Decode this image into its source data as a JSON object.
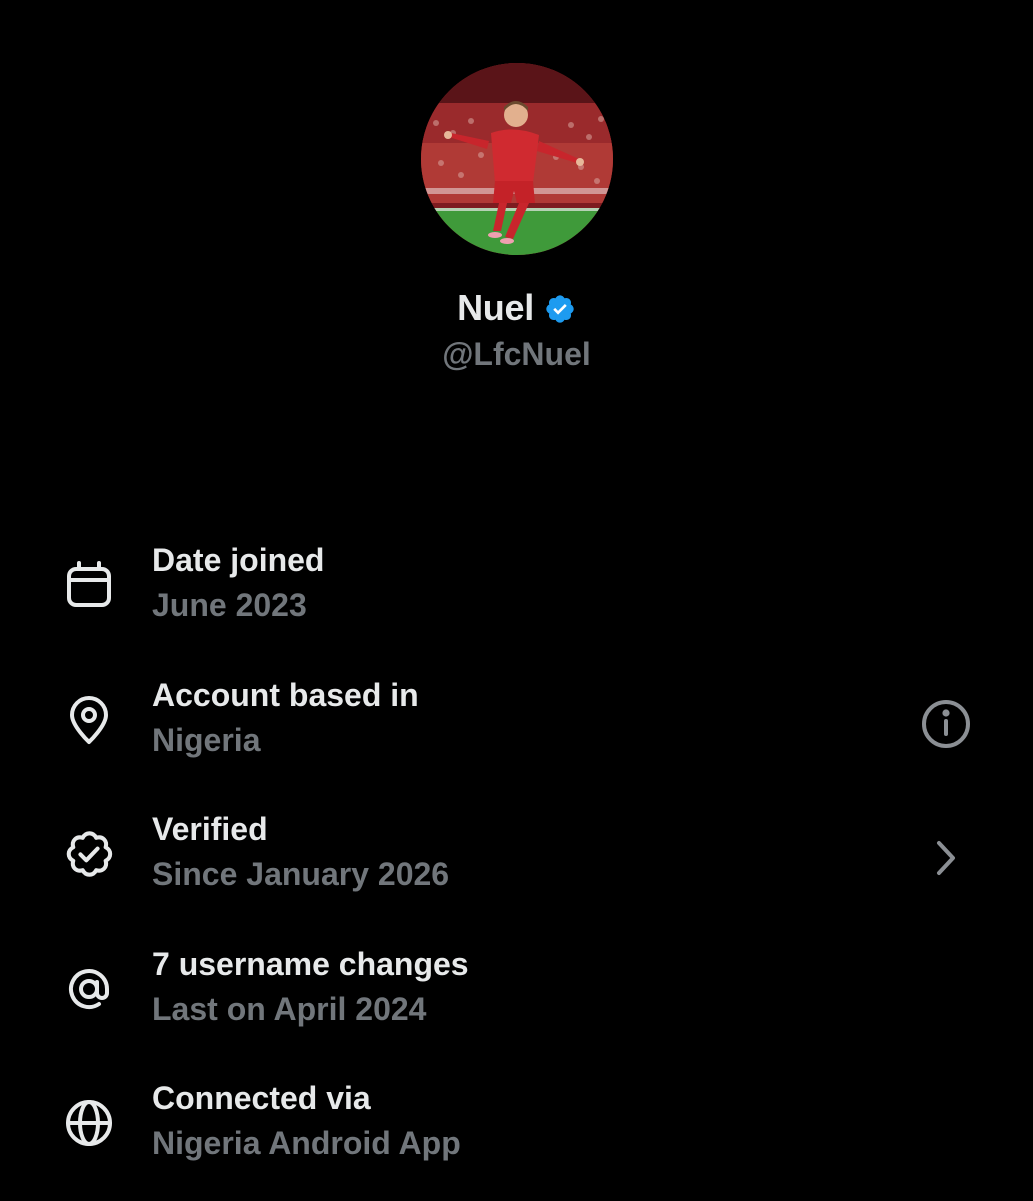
{
  "profile": {
    "display_name": "Nuel",
    "handle": "@LfcNuel",
    "verified": true,
    "verified_badge_color": "#1d9bf0"
  },
  "info_rows": [
    {
      "icon": "calendar-icon",
      "title": "Date joined",
      "subtitle": "June 2023"
    },
    {
      "icon": "location-pin-icon",
      "title": "Account based in",
      "subtitle": "Nigeria",
      "action_icon": "info-icon"
    },
    {
      "icon": "verified-outline-icon",
      "title": "Verified",
      "subtitle": "Since January 2026",
      "action_icon": "chevron-right-icon"
    },
    {
      "icon": "at-sign-icon",
      "title": "7 username changes",
      "subtitle": "Last on April 2024"
    },
    {
      "icon": "globe-icon",
      "title": "Connected via",
      "subtitle": "Nigeria Android App"
    }
  ],
  "colors": {
    "background": "#000000",
    "primary_text": "#e7e9ea",
    "secondary_text": "#71767b",
    "accent": "#1d9bf0"
  }
}
